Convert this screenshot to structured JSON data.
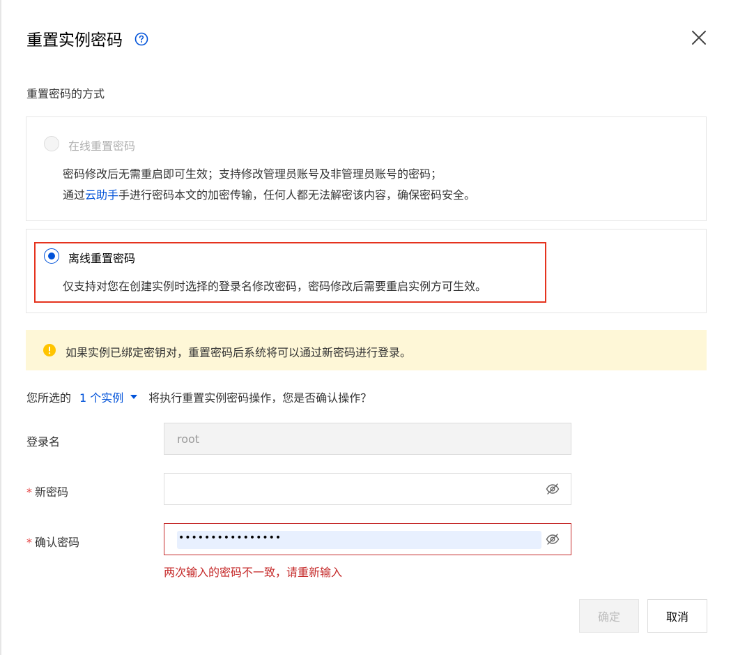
{
  "dialog": {
    "title": "重置实例密码",
    "help_icon": "question-circle-icon",
    "close_icon": "close-icon"
  },
  "method": {
    "label": "重置密码的方式",
    "options": [
      {
        "title": "在线重置密码",
        "state": "disabled",
        "desc_line1": "密码修改后无需重启即可生效；支持修改管理员账号及非管理员账号的密码；",
        "desc_line2_prefix": "通过",
        "desc_line2_link": "云助手",
        "desc_line2_suffix": "手进行密码本文的加密传输，任何人都无法解密该内容，确保密码安全。"
      },
      {
        "title": "离线重置密码",
        "state": "checked",
        "desc": "仅支持对您在创建实例时选择的登录名修改密码，密码修改后需要重启实例方可生效。"
      }
    ]
  },
  "alert": {
    "icon": "warning-circle-icon",
    "text": "如果实例已绑定密钥对，重置密码后系统将可以通过新密码进行登录。"
  },
  "selection": {
    "prefix": "您所选的",
    "link": "1 个实例",
    "suffix": "将执行重置实例密码操作，您是否确认操作？"
  },
  "form": {
    "login": {
      "label": "登录名",
      "value": "root"
    },
    "new_password": {
      "required_mark": "*",
      "label": "新密码",
      "value": ""
    },
    "confirm_password": {
      "required_mark": "*",
      "label": "确认密码",
      "value": "••••••••••••••••"
    },
    "error": "两次输入的密码不一致，请重新输入"
  },
  "buttons": {
    "confirm": "确定",
    "cancel": "取消"
  },
  "colors": {
    "brand": "#0052d9",
    "error": "#c52a2a",
    "highlight": "#e5331e",
    "alert_bg": "#fef7d7",
    "warning": "#ffc400"
  }
}
